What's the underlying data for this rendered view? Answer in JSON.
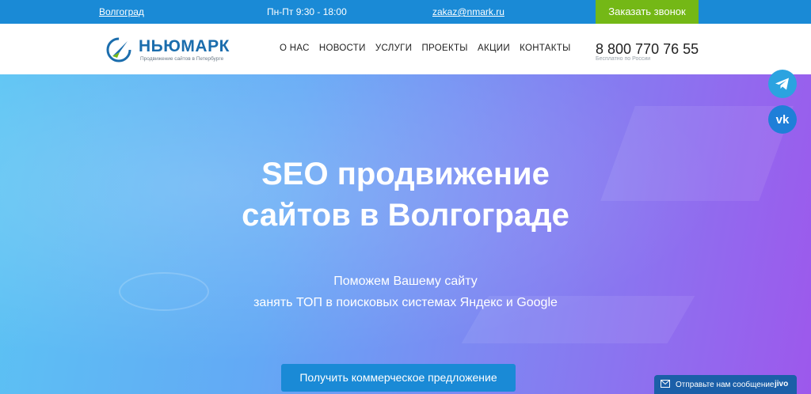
{
  "topbar": {
    "city": "Волгоград",
    "hours": "Пн-Пт 9:30 - 18:00",
    "email": "zakaz@nmark.ru",
    "callback_label": "Заказать звонок"
  },
  "header": {
    "logo_name": "НЬЮМАРК",
    "logo_tagline": "Продвижение сайтов в Петербурге",
    "nav": [
      "О НАС",
      "НОВОСТИ",
      "УСЛУГИ",
      "ПРОЕКТЫ",
      "АКЦИИ",
      "КОНТАКТЫ"
    ],
    "phone": "8 800 770 76 55",
    "phone_note": "Бесплатно по России"
  },
  "hero": {
    "title_line1": "SEO продвижение",
    "title_line2": "сайтов в Волгограде",
    "subtitle_line1": "Поможем Вашему сайту",
    "subtitle_line2": "занять ТОП в поисковых системах Яндекс и Google",
    "cta_label": "Получить коммерческое предложение"
  },
  "social": {
    "telegram_icon": "telegram-icon",
    "vk_icon": "vk-icon"
  },
  "chat": {
    "label": "Отправьте нам сообщение",
    "brand": "jivo"
  },
  "colors": {
    "topbar": "#1a8ad6",
    "callback": "#74b816",
    "brand": "#1b6dad",
    "cta": "#1a8ad6"
  }
}
